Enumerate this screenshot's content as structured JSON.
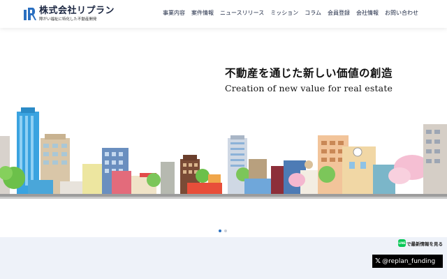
{
  "brand": {
    "name": "株式会社リプラン",
    "tagline": "障がい福祉に特化した不動産開発",
    "color": "#1a2540",
    "accent": "#2a6fc0"
  },
  "nav": {
    "items": [
      {
        "label": "事業内容"
      },
      {
        "label": "案件情報"
      },
      {
        "label": "ニュースリリース"
      },
      {
        "label": "ミッション"
      },
      {
        "label": "コラム"
      },
      {
        "label": "会員登録"
      },
      {
        "label": "会社情報"
      },
      {
        "label": "お問い合わせ"
      }
    ]
  },
  "hero": {
    "title": "不動産を通じた新しい価値の創造",
    "subtitle": "Creation of new value for real estate",
    "illustration_icon": "city-skyline-illustration",
    "slides": 2,
    "active_slide": 1
  },
  "social": {
    "line_label": "で最新情報を見る",
    "line_badge": "LINE",
    "line_color": "#06c755",
    "x_handle": "@replan_funding",
    "x_icon": "x-logo-icon"
  }
}
